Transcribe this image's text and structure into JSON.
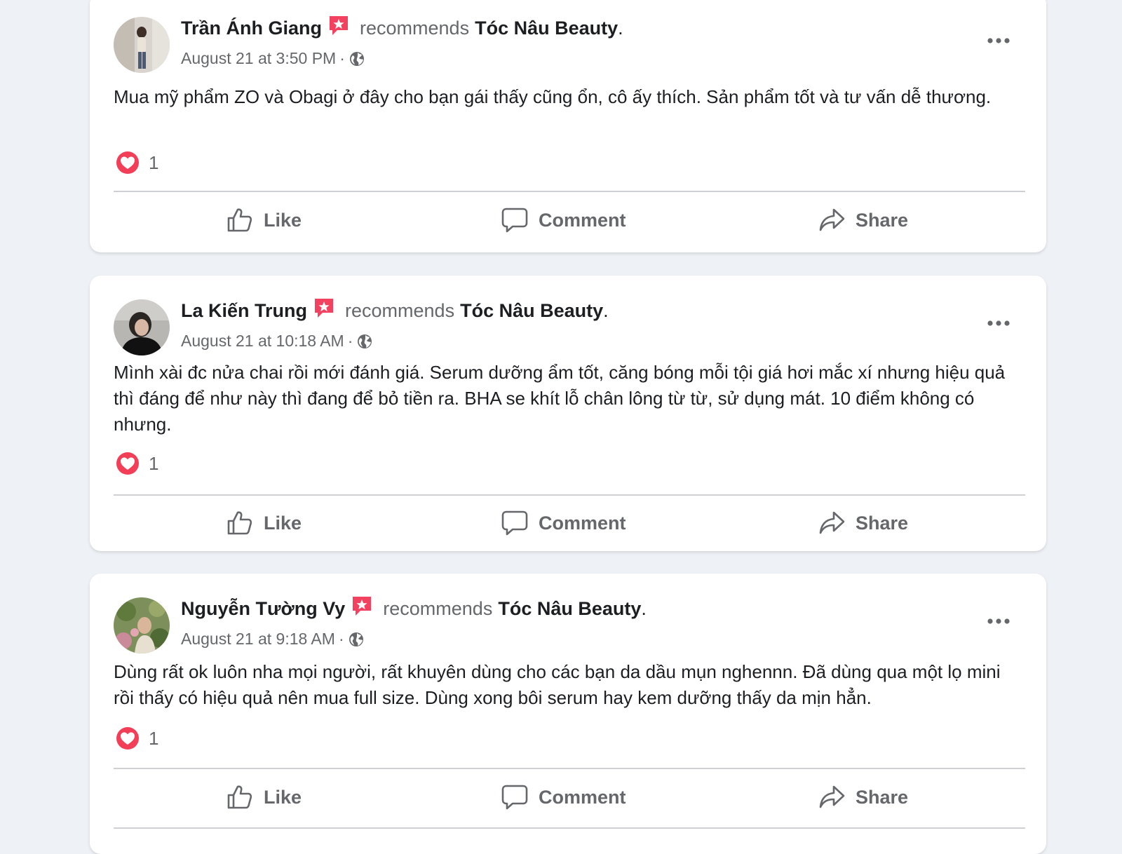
{
  "posts": [
    {
      "author": "Trần Ánh Giang",
      "recommends_label": "recommends",
      "page_name": "Tóc Nâu Beauty",
      "period": ".",
      "timestamp": "August 21 at 3:50 PM",
      "separator": "·",
      "text": "Mua mỹ phẩm ZO và Obagi ở đây cho bạn gái thấy cũng ổn, cô ấy thích. Sản phẩm tốt và tư vấn dễ thương.",
      "reaction_count": "1"
    },
    {
      "author": "La Kiến Trung",
      "recommends_label": "recommends",
      "page_name": "Tóc Nâu Beauty",
      "period": ".",
      "timestamp": "August 21 at 10:18 AM",
      "separator": "·",
      "text": "Mình xài đc nửa chai rồi mới đánh giá. Serum dưỡng ẩm tốt, căng bóng mỗi tội giá hơi mắc xí nhưng hiệu quả thì đáng để như này thì đang để bỏ tiền ra. BHA se khít lỗ chân lông từ từ, sử dụng mát. 10 điểm không có nhưng.",
      "reaction_count": "1"
    },
    {
      "author": "Nguyễn Tường Vy",
      "recommends_label": "recommends",
      "page_name": "Tóc Nâu Beauty",
      "period": ".",
      "timestamp": "August 21 at 9:18 AM",
      "separator": "·",
      "text": "Dùng rất ok luôn nha mọi người, rất khuyên dùng cho các bạn da dầu mụn nghennn. Đã dùng qua một lọ mini rồi thấy có hiệu quả nên mua full size. Dùng xong bôi serum hay kem dưỡng thấy da mịn hẳn.",
      "reaction_count": "1"
    }
  ],
  "actions": {
    "like_label": "Like",
    "comment_label": "Comment",
    "share_label": "Share"
  },
  "icons": {
    "recommend_badge": "recommend-star-icon",
    "audience": "globe-icon",
    "reaction": "heart-icon",
    "more": "more-options-icon",
    "like": "thumbs-up-icon",
    "comment": "comment-bubble-icon",
    "share": "share-arrow-icon"
  },
  "colors": {
    "background": "#eef1f5",
    "card": "#ffffff",
    "primary_text": "#1c1e21",
    "secondary_text": "#65676b",
    "recommend_red": "#f3425f",
    "divider": "#ced0d4"
  }
}
